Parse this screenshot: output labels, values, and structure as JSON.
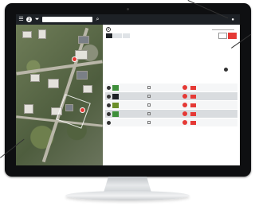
{
  "map": {
    "badge": "2",
    "menu_icon": "hamburger-icon",
    "filter_icon": "filter-icon",
    "search_icon": "search-icon"
  },
  "header": {
    "user_icon": "user-icon"
  },
  "detail": {
    "icon": "pin-icon"
  },
  "location_rows": [
    {
      "dark": false,
      "thumb_color": "#3e8f3a"
    },
    {
      "dark": true,
      "thumb_color": "#1d2126"
    },
    {
      "dark": false,
      "thumb_color": "#6b8f2a"
    },
    {
      "dark": true,
      "thumb_color": "#3e8f3a"
    },
    {
      "dark": false,
      "thumb_color": "#f5f6f7"
    }
  ],
  "colors": {
    "topbar": "#1d2126",
    "accent_red": "#e53935",
    "brand_orange": "#f08a00"
  }
}
